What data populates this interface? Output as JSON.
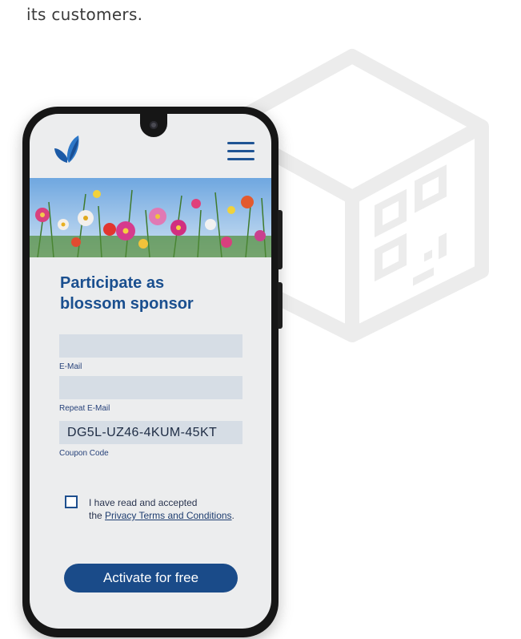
{
  "intro": {
    "text": "its customers."
  },
  "app": {
    "title_line1": "Participate as",
    "title_line2": "blossom sponsor",
    "fields": [
      {
        "label": "E-Mail",
        "value": ""
      },
      {
        "label": "Repeat E-Mail",
        "value": ""
      },
      {
        "label": "Coupon Code",
        "value": "DG5L-UZ46-4KUM-45KT"
      }
    ],
    "consent_prefix": "I have read and accepted",
    "consent_the": "the",
    "consent_link": "Privacy Terms and Conditions",
    "consent_suffix": ".",
    "activate_label": "Activate for free"
  },
  "icons": {
    "logo": "butterfly-logo-icon",
    "menu": "hamburger-menu-icon",
    "background": "qr-code-box-icon",
    "checkbox": "checkbox-unchecked"
  },
  "colors": {
    "brand_blue": "#1a4b89",
    "field_bg": "#d6dde5",
    "screen_bg": "#ecedee"
  }
}
